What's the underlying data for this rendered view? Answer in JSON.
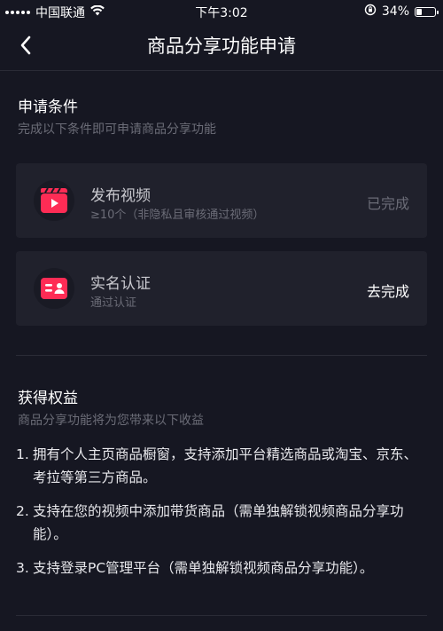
{
  "status_bar": {
    "carrier": "中国联通",
    "time": "下午3:02",
    "battery_text": "34%",
    "battery_level": 0.34,
    "icons": [
      "signal-icon",
      "wifi-icon",
      "rotation-lock-icon",
      "battery-icon"
    ]
  },
  "nav": {
    "title": "商品分享功能申请",
    "back_icon": "chevron-left-icon"
  },
  "conditions": {
    "title": "申请条件",
    "subtitle": "完成以下条件即可申请商品分享功能",
    "items": [
      {
        "icon": "video-clapper-icon",
        "title": "发布视频",
        "subtitle": "≥10个（非隐私且审核通过视频）",
        "action": "已完成"
      },
      {
        "icon": "id-card-icon",
        "title": "实名认证",
        "subtitle": "通过认证",
        "action": "去完成"
      }
    ]
  },
  "benefits": {
    "title": "获得权益",
    "subtitle": "商品分享功能将为您带来以下收益",
    "items": [
      {
        "num": "1.",
        "text": "拥有个人主页商品橱窗，支持添加平台精选商品或淘宝、京东、考拉等第三方商品。"
      },
      {
        "num": "2.",
        "text": "支持在您的视频中添加带货商品（需单独解锁视频商品分享功能）。"
      },
      {
        "num": "3.",
        "text": "支持登录PC管理平台（需单独解锁视频商品分享功能）。"
      }
    ]
  },
  "colors": {
    "background": "#161722",
    "card": "#20212c",
    "accent": "#fe2c55",
    "muted_text": "#6b6c77"
  }
}
